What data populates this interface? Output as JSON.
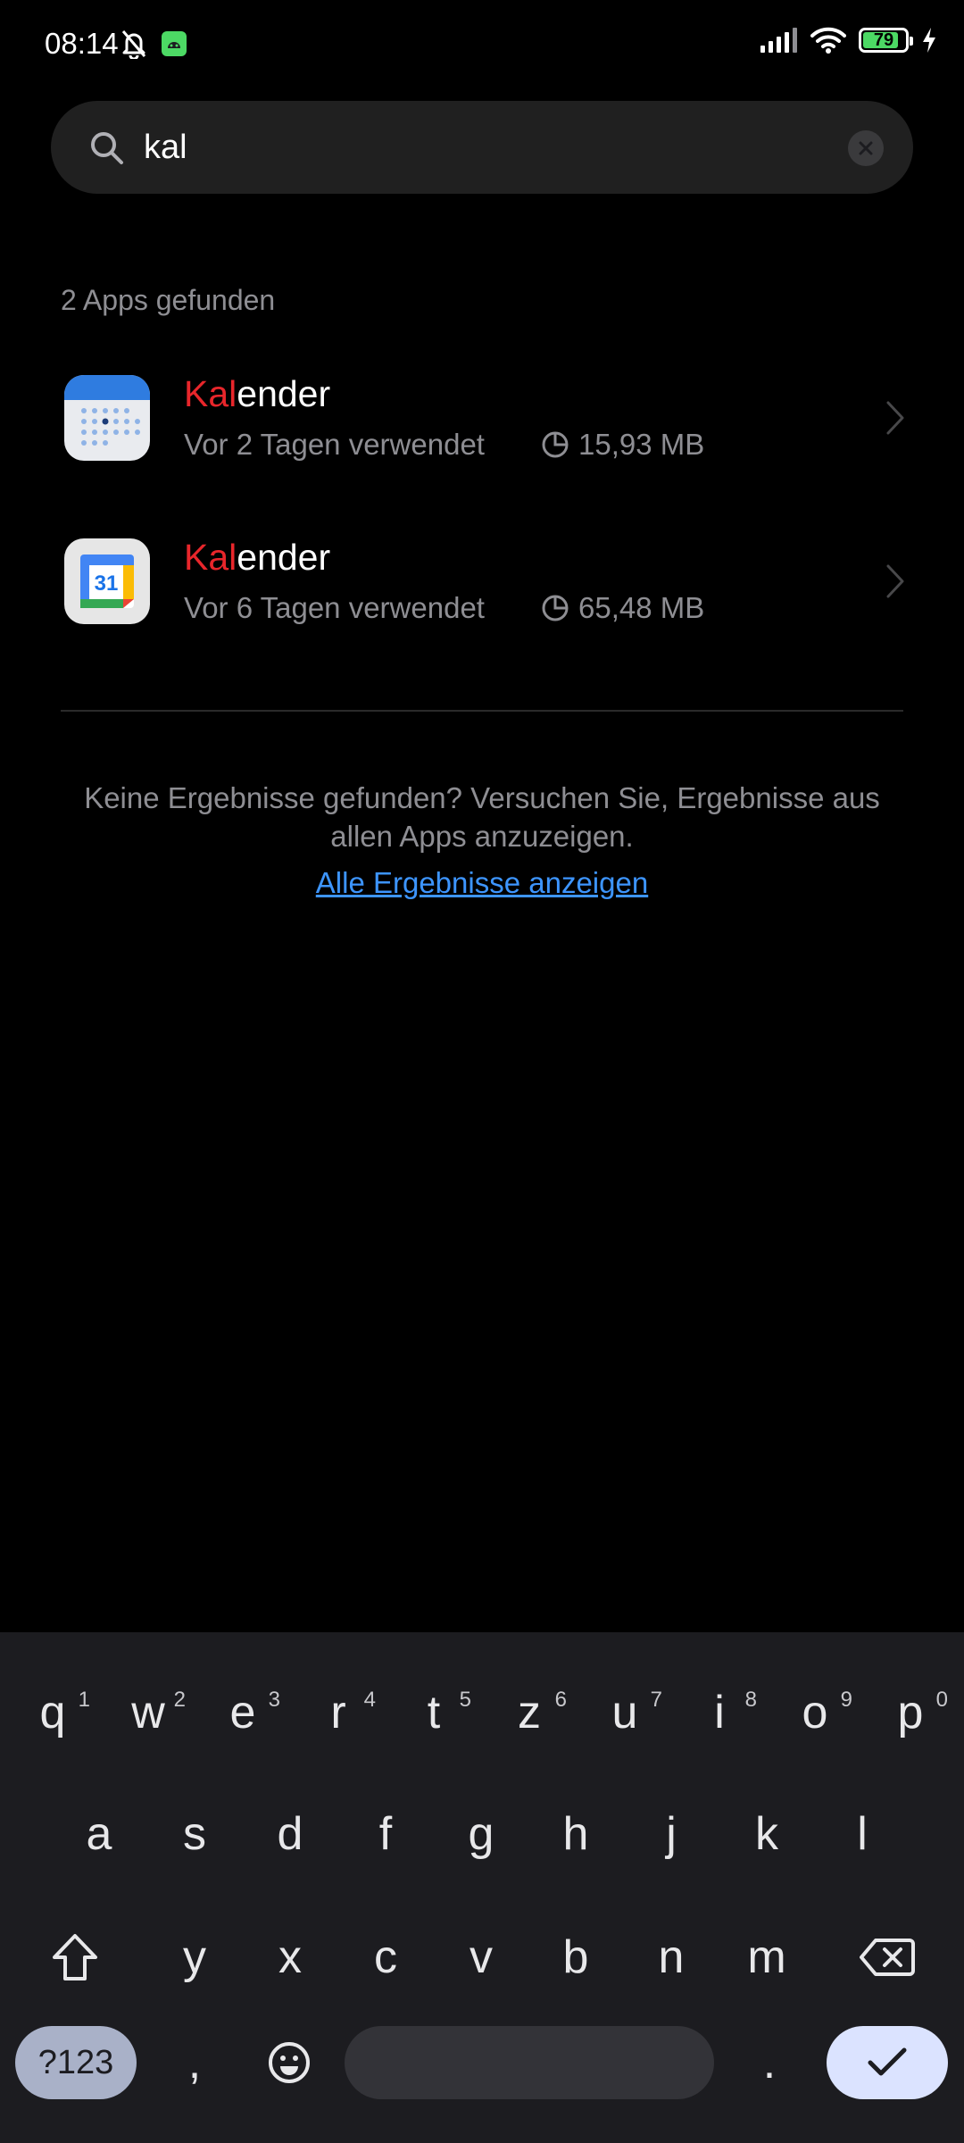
{
  "status_bar": {
    "time": "08:14",
    "battery": "79",
    "battery_color": "#4cd964"
  },
  "search": {
    "query": "kal",
    "icon": "search-icon",
    "clear_icon": "close-icon"
  },
  "result_count": "2 Apps gefunden",
  "apps": [
    {
      "name_highlight": "Kal",
      "name_rest": "ender",
      "last_used": "Vor 2 Tagen verwendet",
      "size": "15,93 MB",
      "icon": "xiaomi-calendar-icon"
    },
    {
      "name_highlight": "Kal",
      "name_rest": "ender",
      "last_used": "Vor 6 Tagen verwendet",
      "size": "65,48 MB",
      "icon": "google-calendar-icon",
      "icon_label": "31"
    }
  ],
  "no_results": {
    "message": "Keine Ergebnisse gefunden? Versuchen Sie, Ergebnisse aus allen Apps anzuzeigen.",
    "link": "Alle Ergebnisse anzeigen"
  },
  "keyboard": {
    "row1": [
      {
        "k": "q",
        "h": "1"
      },
      {
        "k": "w",
        "h": "2"
      },
      {
        "k": "e",
        "h": "3"
      },
      {
        "k": "r",
        "h": "4"
      },
      {
        "k": "t",
        "h": "5"
      },
      {
        "k": "z",
        "h": "6"
      },
      {
        "k": "u",
        "h": "7"
      },
      {
        "k": "i",
        "h": "8"
      },
      {
        "k": "o",
        "h": "9"
      },
      {
        "k": "p",
        "h": "0"
      }
    ],
    "row2": [
      "a",
      "s",
      "d",
      "f",
      "g",
      "h",
      "j",
      "k",
      "l"
    ],
    "row3": [
      "y",
      "x",
      "c",
      "v",
      "b",
      "n",
      "m"
    ],
    "symbols_label": "?123",
    "comma": ",",
    "period": ".",
    "accent_color": "#3d95ff"
  }
}
